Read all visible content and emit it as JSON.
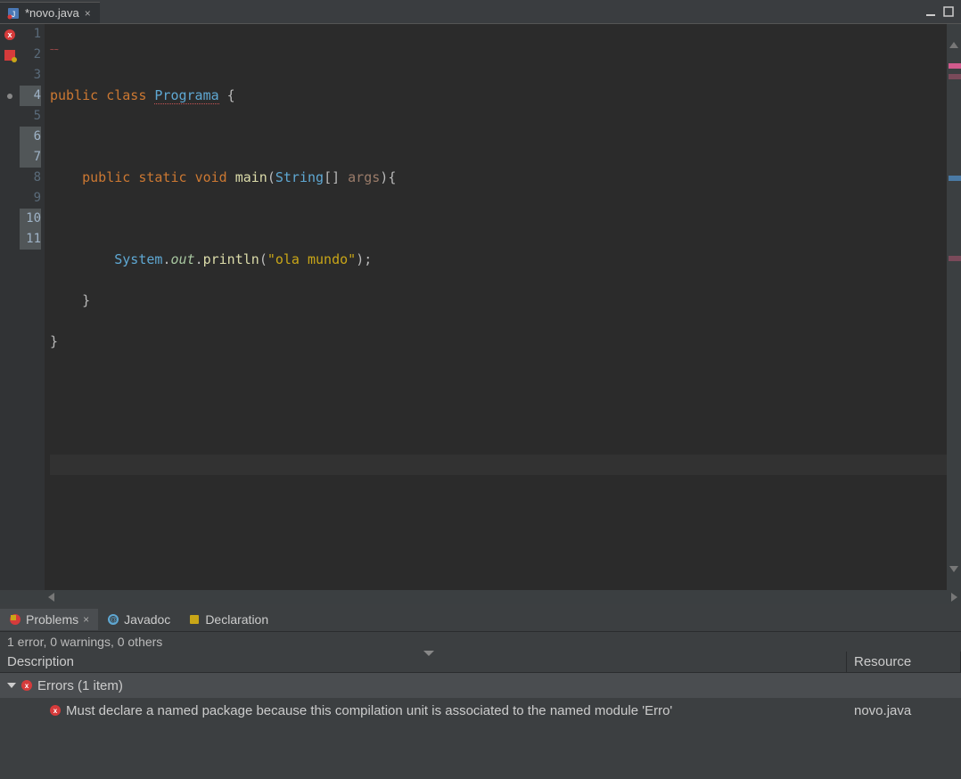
{
  "editorTab": {
    "label": "*novo.java"
  },
  "lineNumbers": [
    "1",
    "2",
    "3",
    "4",
    "5",
    "6",
    "7",
    "8",
    "9",
    "10",
    "11"
  ],
  "code": {
    "l2_public": "public",
    "l2_class": "class",
    "l2_name": "Programa",
    "l2_brace": " {",
    "l4_public": "public",
    "l4_static": "static",
    "l4_void": "void",
    "l4_main": "main",
    "l4_paren1": "(",
    "l4_string": "String",
    "l4_brackets": "[] ",
    "l4_args": "args",
    "l4_paren2": ")",
    "l4_brace": "{",
    "l6_system": "System",
    "l6_dot1": ".",
    "l6_out": "out",
    "l6_dot2": ".",
    "l6_println": "println",
    "l6_paren1": "(",
    "l6_str": "\"ola mundo\"",
    "l6_paren2": ")",
    "l6_semi": ";",
    "l7_brace": "}",
    "l8_brace": "}"
  },
  "panelTabs": {
    "problems": "Problems",
    "javadoc": "Javadoc",
    "declaration": "Declaration"
  },
  "statusLine": "1 error, 0 warnings, 0 others",
  "columns": {
    "description": "Description",
    "resource": "Resource"
  },
  "errorsGroup": "Errors (1 item)",
  "errorMsg": "Must declare a named package because this compilation unit is associated to the named module 'Erro'",
  "errorResource": "novo.java"
}
